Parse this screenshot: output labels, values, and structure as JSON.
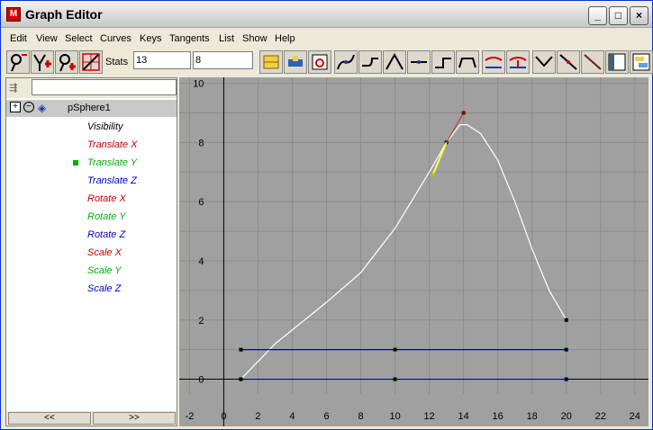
{
  "window": {
    "title": "Graph Editor",
    "app_icon": "maya-icon"
  },
  "menu": [
    "Edit",
    "View",
    "Select",
    "Curves",
    "Keys",
    "Tangents",
    "List",
    "Show",
    "Help"
  ],
  "toolbar": {
    "stats_label": "Stats",
    "stats_field_1": "13",
    "stats_field_2": "8"
  },
  "outliner": {
    "object": "pSphere1",
    "attributes": [
      {
        "label": "Visibility",
        "color": "#000000"
      },
      {
        "label": "Translate X",
        "color": "#c00000"
      },
      {
        "label": "Translate Y",
        "color": "#00b000",
        "selected": true
      },
      {
        "label": "Translate Z",
        "color": "#0000c0"
      },
      {
        "label": "Rotate X",
        "color": "#c00000"
      },
      {
        "label": "Rotate Y",
        "color": "#00b000"
      },
      {
        "label": "Rotate Z",
        "color": "#0000c0"
      },
      {
        "label": "Scale X",
        "color": "#c00000"
      },
      {
        "label": "Scale Y",
        "color": "#00b000"
      },
      {
        "label": "Scale Z",
        "color": "#0000c0"
      }
    ],
    "scroll_left": "<<",
    "scroll_right": ">>"
  },
  "chart_data": {
    "type": "line",
    "x_ticks": [
      -2,
      0,
      2,
      4,
      6,
      8,
      10,
      12,
      14,
      16,
      18,
      20,
      22,
      24
    ],
    "y_ticks": [
      0,
      2,
      4,
      6,
      8,
      10
    ],
    "xlim": [
      -2.6,
      24.8
    ],
    "ylim": [
      -0.5,
      10.2
    ],
    "series": [
      {
        "color": "#ffffff",
        "points": [
          [
            1,
            0
          ],
          [
            3,
            1.2
          ],
          [
            6,
            2.6
          ],
          [
            8,
            3.6
          ],
          [
            10,
            5.1
          ],
          [
            12,
            7.0
          ],
          [
            13,
            8.0
          ],
          [
            13.8,
            8.6
          ],
          [
            14.2,
            8.6
          ],
          [
            15,
            8.3
          ],
          [
            16,
            7.4
          ],
          [
            17,
            6.0
          ],
          [
            18,
            4.4
          ],
          [
            19,
            3.0
          ],
          [
            20,
            2.0
          ]
        ],
        "keys": [
          [
            1,
            0
          ],
          [
            13,
            8
          ],
          [
            20,
            2
          ]
        ]
      },
      {
        "color": "#0000c0",
        "points": [
          [
            1,
            1
          ],
          [
            20,
            1
          ]
        ],
        "keys": [
          [
            1,
            1
          ],
          [
            10,
            1
          ],
          [
            20,
            1
          ]
        ]
      },
      {
        "color": "#0000c0",
        "points": [
          [
            1,
            0
          ],
          [
            20,
            0
          ]
        ],
        "keys": [
          [
            1,
            0
          ],
          [
            10,
            0
          ],
          [
            20,
            0
          ]
        ]
      }
    ],
    "tangent": {
      "selected_color": "#ffff40",
      "out_color": "#c04040",
      "in": [
        12.2,
        6.9
      ],
      "out": [
        14,
        9
      ]
    }
  }
}
